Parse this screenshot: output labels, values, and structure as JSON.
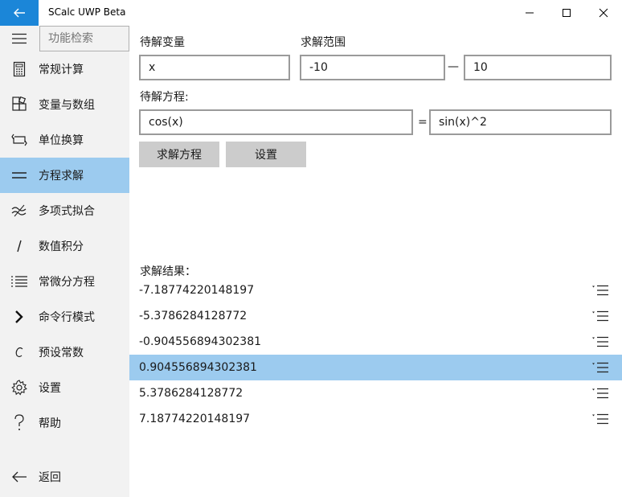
{
  "window": {
    "title": "SCalc UWP Beta"
  },
  "sidebar": {
    "search_placeholder": "功能检索",
    "items": [
      {
        "label": "常规计算",
        "icon": "calculator-icon"
      },
      {
        "label": "变量与数组",
        "icon": "blocks-icon"
      },
      {
        "label": "单位换算",
        "icon": "swap-icon"
      },
      {
        "label": "方程求解",
        "icon": "equals-icon"
      },
      {
        "label": "多项式拟合",
        "icon": "wave-icon"
      },
      {
        "label": "数值积分",
        "icon": "integral-icon"
      },
      {
        "label": "常微分方程",
        "icon": "list-icon"
      },
      {
        "label": "命令行模式",
        "icon": "chevron-right-icon"
      },
      {
        "label": "预设常数",
        "icon": "constant-icon"
      },
      {
        "label": "设置",
        "icon": "gear-icon"
      },
      {
        "label": "帮助",
        "icon": "question-icon"
      }
    ],
    "active_index": 3,
    "back_label": "返回"
  },
  "form": {
    "variable_label": "待解变量",
    "variable_value": "x",
    "range_label": "求解范围",
    "range_min": "-10",
    "range_sep": "—",
    "range_max": "10",
    "equation_label": "待解方程:",
    "equation_left": "cos(x)",
    "equals": "=",
    "equation_right": "sin(x)^2",
    "solve_button": "求解方程",
    "settings_button": "设置"
  },
  "results": {
    "label": "求解结果：",
    "values": [
      "-7.18774220148197",
      "-5.3786284128772",
      "-0.904556894302381",
      "0.904556894302381",
      "5.3786284128772",
      "7.18774220148197"
    ],
    "selected_index": 3
  },
  "colors": {
    "accent": "#1b86d8",
    "selection": "#9ccbef",
    "sidebar_bg": "#f2f2f2",
    "button_bg": "#cccccc"
  }
}
